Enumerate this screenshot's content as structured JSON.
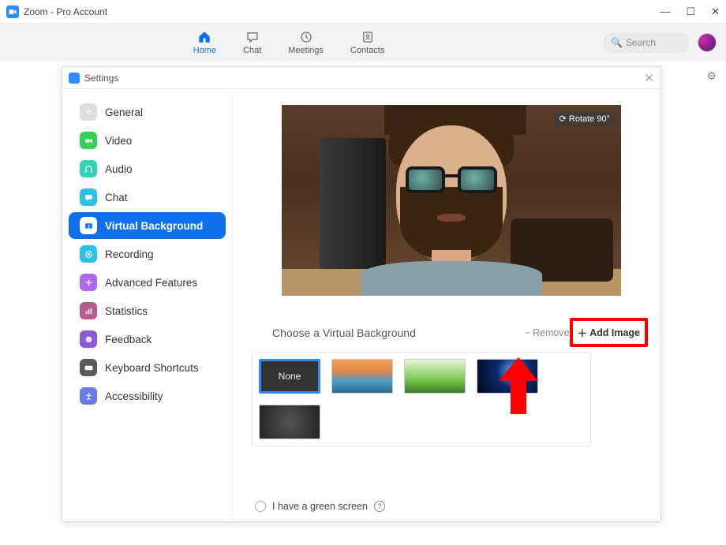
{
  "window": {
    "title": "Zoom - Pro Account"
  },
  "nav": {
    "items": [
      {
        "icon": "home-icon",
        "label": "Home",
        "active": true
      },
      {
        "icon": "chat-icon",
        "label": "Chat",
        "active": false
      },
      {
        "icon": "clock-icon",
        "label": "Meetings",
        "active": false
      },
      {
        "icon": "contacts-icon",
        "label": "Contacts",
        "active": false
      }
    ]
  },
  "search": {
    "placeholder": "Search"
  },
  "settings_panel": {
    "title": "Settings",
    "sidebar": {
      "items": [
        {
          "name": "general",
          "label": "General"
        },
        {
          "name": "video",
          "label": "Video"
        },
        {
          "name": "audio",
          "label": "Audio"
        },
        {
          "name": "chat",
          "label": "Chat"
        },
        {
          "name": "virtual-background",
          "label": "Virtual Background",
          "active": true
        },
        {
          "name": "recording",
          "label": "Recording"
        },
        {
          "name": "advanced-features",
          "label": "Advanced Features"
        },
        {
          "name": "statistics",
          "label": "Statistics"
        },
        {
          "name": "feedback",
          "label": "Feedback"
        },
        {
          "name": "keyboard-shortcuts",
          "label": "Keyboard Shortcuts"
        },
        {
          "name": "accessibility",
          "label": "Accessibility"
        }
      ]
    },
    "preview": {
      "rotate_label": "Rotate 90°"
    },
    "vb": {
      "section_title": "Choose a Virtual Background",
      "remove_label": "Remove",
      "add_label": "Add Image",
      "thumbs": [
        {
          "id": "none",
          "label": "None",
          "selected": true
        },
        {
          "id": "bridge",
          "label": ""
        },
        {
          "id": "grass",
          "label": ""
        },
        {
          "id": "space",
          "label": ""
        },
        {
          "id": "dark",
          "label": ""
        }
      ],
      "green_screen_label": "I have a green screen"
    }
  },
  "annotation": {
    "highlight": "add-image"
  }
}
